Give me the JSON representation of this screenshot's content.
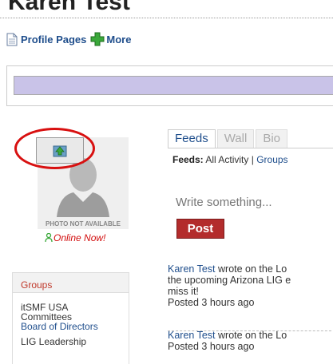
{
  "page": {
    "title": "Karen Test"
  },
  "actions": {
    "profile_pages": "Profile Pages",
    "more": "More"
  },
  "profile": {
    "photo_caption": "PHOTO NOT AVAILABLE",
    "online_status": "Online Now!",
    "upload_icon": "upload-photo-icon"
  },
  "tabs": [
    "Feeds",
    "Wall",
    "Bio"
  ],
  "feeds_filter": {
    "label": "Feeds:",
    "all_activity": "All Activity",
    "separator": "|",
    "groups": "Groups"
  },
  "status_box": {
    "placeholder": "Write something..."
  },
  "post_button": "Post",
  "feed_items": [
    {
      "author": "Karen Test",
      "text_1": " wrote on the Lo",
      "line_2": "the upcoming Arizona LIG e",
      "line_3": "miss it!",
      "time": "Posted 3 hours ago"
    },
    {
      "author": "Karen Test",
      "text_1": " wrote on the Lo",
      "time": "Posted 3 hours ago"
    }
  ],
  "groups": {
    "header": "Groups",
    "items": [
      {
        "name_line1": "itSMF USA",
        "name_line2": "Committees",
        "link": "Board of Directors"
      },
      {
        "name_line1": "LIG Leadership"
      }
    ]
  },
  "colors": {
    "accent": "#1f4e8c",
    "post_button": "#b32c2c",
    "online": "#d20d0d",
    "highlight_circle": "#d81010",
    "banner": "#c9c3e8"
  }
}
